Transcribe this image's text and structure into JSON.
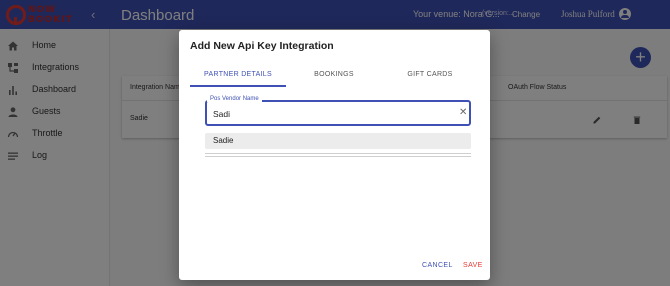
{
  "logo": {
    "line1": "NOW",
    "line2": "BOOKIT"
  },
  "header": {
    "title": "Dashboard",
    "venue": "Your venue: Nora G...",
    "version": "(version:...",
    "change": "Change",
    "user": "Joshua Pulford"
  },
  "sidebar": {
    "items": [
      {
        "label": "Home",
        "icon": "home-icon"
      },
      {
        "label": "Integrations",
        "icon": "integrations-icon"
      },
      {
        "label": "Dashboard",
        "icon": "bar-chart-icon"
      },
      {
        "label": "Guests",
        "icon": "person-icon"
      },
      {
        "label": "Throttle",
        "icon": "speedometer-icon"
      },
      {
        "label": "Log",
        "icon": "list-icon"
      }
    ]
  },
  "table": {
    "headers": [
      "Integration Name",
      "OAuth Flow Status"
    ],
    "rows": [
      {
        "name": "Sadie"
      }
    ]
  },
  "dialog": {
    "title": "Add New Api Key Integration",
    "tabs": [
      "PARTNER DETAILS",
      "BOOKINGS",
      "GIFT CARDS"
    ],
    "active_tab": "PARTNER DETAILS",
    "field": {
      "label": "Pos Vendor Name",
      "value": "Sadi"
    },
    "options": [
      "Sadie"
    ],
    "cancel": "CANCEL",
    "save": "SAVE"
  },
  "colors": {
    "primary": "#3f51b5",
    "accent": "#e53935"
  }
}
